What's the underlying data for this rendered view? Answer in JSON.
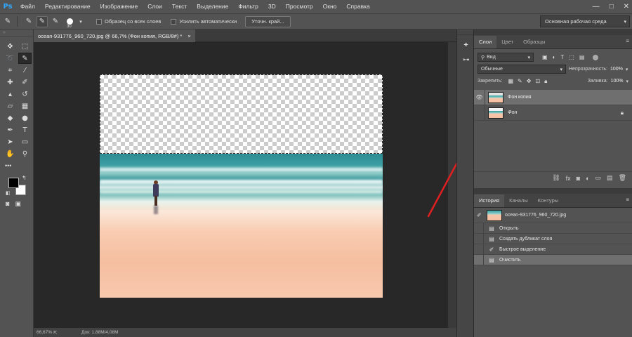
{
  "app": {
    "logo": "Ps",
    "window_controls": [
      "—",
      "□",
      "✕"
    ]
  },
  "menu": [
    "Файл",
    "Редактирование",
    "Изображение",
    "Слои",
    "Текст",
    "Выделение",
    "Фильтр",
    "3D",
    "Просмотр",
    "Окно",
    "Справка"
  ],
  "options": {
    "brush_size": "30",
    "sample_all_layers": "Образец со всех слоев",
    "auto_enhance": "Усилить автоматически",
    "refine_edge": "Уточн. край...",
    "workspace": "Основная рабочая среда"
  },
  "document": {
    "tab_title": "ocean-931776_960_720.jpg @ 66,7% (Фон копия, RGB/8#) *",
    "close": "×",
    "zoom": "66,67%",
    "doc_info": "Док: 1,88M/4,08M"
  },
  "layers_panel": {
    "tabs": [
      "Слои",
      "Цвет",
      "Образцы"
    ],
    "filter_label": "Вид",
    "blend_mode": "Обычные",
    "opacity_label": "Непрозрачность:",
    "opacity_value": "100%",
    "lock_label": "Закрепить:",
    "fill_label": "Заливка:",
    "fill_value": "100%",
    "layers": [
      {
        "name": "Фон копия",
        "visible": true,
        "selected": true,
        "locked": false
      },
      {
        "name": "Фон",
        "visible": false,
        "selected": false,
        "locked": true
      }
    ]
  },
  "history_panel": {
    "tabs": [
      "История",
      "Каналы",
      "Контуры"
    ],
    "snapshot": "ocean-931776_960_720.jpg",
    "steps": [
      {
        "name": "Открыть",
        "icon": "document-icon",
        "selected": false
      },
      {
        "name": "Создать дубликат слоя",
        "icon": "document-icon",
        "selected": false
      },
      {
        "name": "Быстрое выделение",
        "icon": "brush-icon",
        "selected": false
      },
      {
        "name": "Очистить",
        "icon": "document-icon",
        "selected": true
      }
    ]
  },
  "annotation": {
    "color": "#e02020"
  }
}
